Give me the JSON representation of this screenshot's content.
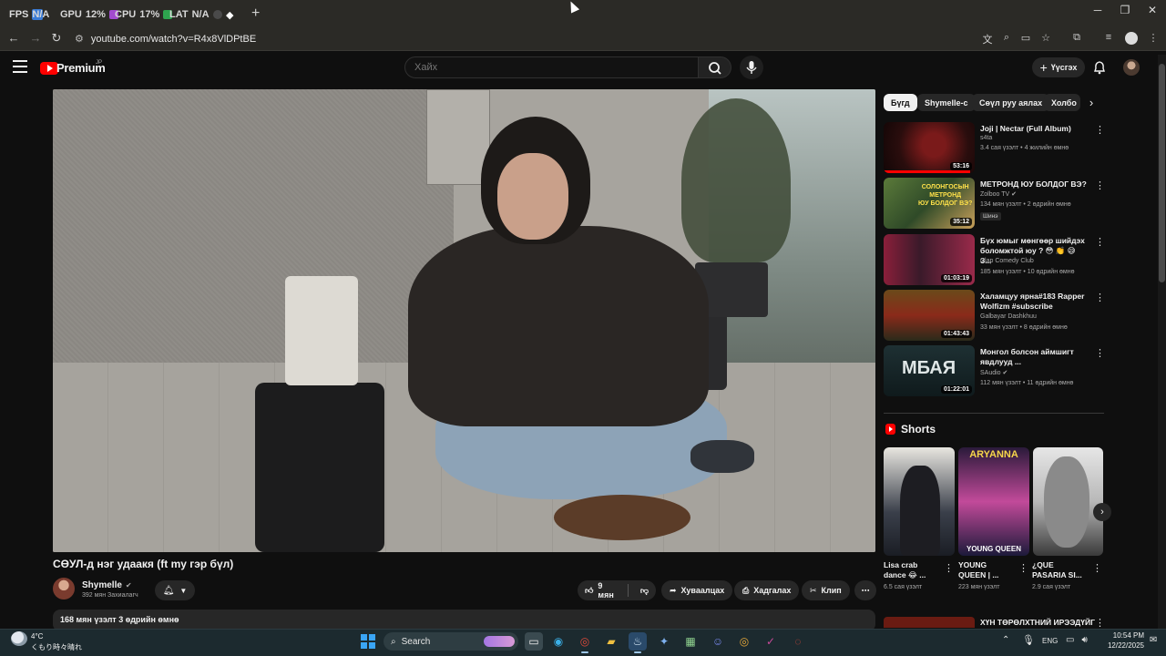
{
  "browser": {
    "tabs": [
      {
        "prefix": "FPS",
        "value": "N/A",
        "icon": "overlay-icon",
        "color": "#3a7bd5"
      },
      {
        "prefix": "GPU",
        "value": "12%",
        "icon": "gpu-icon",
        "color": "#a24bd0"
      },
      {
        "prefix": "CPU",
        "value": "17%",
        "icon": "cpu-icon",
        "color": "#2ea44f"
      },
      {
        "prefix": "LAT",
        "value": "N/A",
        "icon": "latency-icon",
        "color": "#4a4a4a"
      }
    ],
    "address": "youtube.com/watch?v=R4x8VlDPtBE",
    "new_tab": "+"
  },
  "youtube": {
    "brand": "Premium",
    "region": "JP",
    "search_placeholder": "Хайх",
    "create_label": "Үүсгэх",
    "accent": "#ff0000"
  },
  "video": {
    "title": "СӨУЛ-д нэг удаакя (ft my гэр бүл)",
    "channel": "Shymelle",
    "subscribers": "392 мян Захиалагч",
    "likes": "9 мян",
    "share_label": "Хуваалцах",
    "save_label": "Хадгалах",
    "clip_label": "Клип",
    "description_meta": "168 мян үзэлт  3 өдрийн өмнө"
  },
  "sidebar": {
    "chips": [
      "Бүгд",
      "Shymelle-с",
      "Сөүл руу аялах",
      "Холбо"
    ],
    "recommendations": [
      {
        "title": "Joji | Nectar (Full Album)",
        "channel": "s4ta",
        "meta": "3.4 сая үзэлт • 4 жилийн өмнө",
        "duration": "53:16",
        "badge": "",
        "verified": false,
        "watched": 0.95,
        "color": "#2a0d0d"
      },
      {
        "title": "МЕТРОНД ЮУ БОЛДОГ ВЭ?",
        "channel": "Zolboo TV",
        "meta": "134 мян үзэлт • 2 өдрийн өмнө",
        "duration": "35:12",
        "badge": "Шинэ",
        "verified": true,
        "watched": 0,
        "color": "#3a5a2a"
      },
      {
        "title": "Бүх юмыг мөнгөөр шийдэх боломжтой юу ? 😳 👏 😅 З...",
        "channel": "Clap Comedy Club",
        "meta": "185 мян үзэлт • 10 өдрийн өмнө",
        "duration": "01:03:19",
        "badge": "",
        "verified": false,
        "watched": 0,
        "color": "#6a1a2a"
      },
      {
        "title": "Халамцуу ярна#183  Rapper Wolfizm  #subscribe",
        "channel": "Galbayar Dashkhuu",
        "meta": "33 мян үзэлт • 8 өдрийн өмнө",
        "duration": "01:43:43",
        "badge": "",
        "verified": false,
        "watched": 0,
        "color": "#5a3a1a"
      },
      {
        "title": "Монгол болсон аймшигт явдлууд ...",
        "channel": "SAudio",
        "meta": "112 мян үзэлт • 11 өдрийн өмнө",
        "duration": "01:22:01",
        "badge": "",
        "verified": true,
        "watched": 0,
        "color": "#16262a",
        "thumb_text": "МБАЯ"
      }
    ],
    "shorts_heading": "Shorts",
    "shorts": [
      {
        "title": "Lisa crab dance 😂 ...",
        "views": "6.5 сая үзэлт",
        "thumb_text": "",
        "color": "#3a3f4a"
      },
      {
        "title": "YOUNG QUEEN | ...",
        "views": "223 мян үзэлт",
        "thumb_text": "ARYANNA",
        "thumb_text2": "YOUNG QUEEN",
        "color": "#1c1a3a"
      },
      {
        "title": "¿QUE PASARIA SI...",
        "views": "2.9 сая үзэлт",
        "thumb_text": "",
        "color": "#d8d8d8"
      }
    ],
    "next_title": "ХҮН ТӨРӨЛХТНИЙ ИРЭЭДҮЙГ"
  },
  "taskbar": {
    "weather_temp": "4°C",
    "weather_desc": "くもり時々晴れ",
    "search_label": "Search",
    "lang": "ENG",
    "time": "10:54 PM",
    "date": "12/22/2025"
  }
}
